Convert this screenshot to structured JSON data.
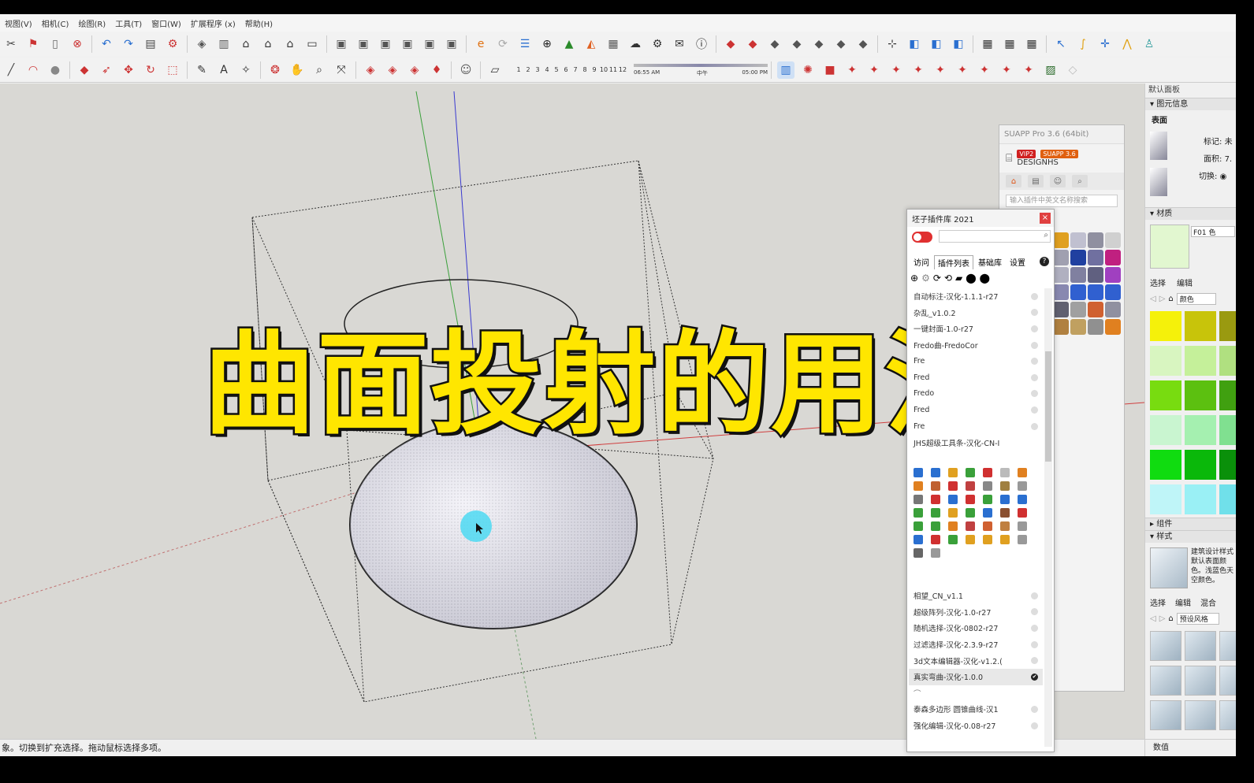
{
  "menu": {
    "items": [
      "视图(V)",
      "相机(C)",
      "绘图(R)",
      "工具(T)",
      "窗口(W)",
      "扩展程序 (x)",
      "帮助(H)"
    ]
  },
  "shadow": {
    "months": [
      "1",
      "2",
      "3",
      "4",
      "5",
      "6",
      "7",
      "8",
      "9",
      "10",
      "11",
      "12"
    ],
    "time_start": "06:55 AM",
    "time_mid": "中午",
    "time_end": "05:00 PM"
  },
  "overlay_title": "曲面投射的用法",
  "status_text": "象。切换到扩充选择。拖动鼠标选择多项。",
  "suapp": {
    "title": "SUAPP Pro 3.6 (64bit)",
    "badge_vip": "VIP2",
    "badge_ver": "SUAPP 3.6",
    "user": "DESIGNHS",
    "search_placeholder": "输入插件中英文名称搜索"
  },
  "plugin_window": {
    "title": "坯子插件库 2021",
    "close": "×",
    "tabs": [
      "访问",
      "插件列表",
      "基础库",
      "设置"
    ],
    "help": "?",
    "items_top": [
      "自动标注-汉化-1.1.1-r27",
      "杂乱_v1.0.2",
      "一键封面-1.0-r27",
      "Fredo曲-FredoCor",
      "Fre",
      "Fred",
      "Fredo",
      "Fred",
      "Fre",
      "JHS超级工具条-汉化-CN-I"
    ],
    "items_bottom": [
      "相望_CN_v1.1",
      "超级阵列-汉化-1.0-r27",
      "随机选择-汉化-0802-r27",
      "过滤选择-汉化-2.3.9-r27",
      "3d文本编辑器-汉化-v1.2.(",
      "真实弯曲-汉化-1.0.0",
      "",
      "泰森多边形 圆锥曲线-汉1",
      "强化编辑-汉化-0.08-r27"
    ],
    "selected_check": "✔"
  },
  "tray": {
    "title": "默认面板",
    "entity_info": "图元信息",
    "face_label": "表面",
    "tag_label": "标记:",
    "tag_value": "未",
    "area_label": "面积:",
    "area_value": "7.",
    "toggle_label": "切换:",
    "materials": "材质",
    "material_name": "F01 色",
    "select_tab": "选择",
    "edit_tab": "编辑",
    "color_dropdown": "颜色",
    "components": "组件",
    "styles": "样式",
    "style_desc": "建筑设计样式 默认表面颜色。浅蓝色天空颜色。",
    "style_select": "选择",
    "style_edit": "编辑",
    "style_mix": "混合",
    "style_dropdown": "预设风格",
    "value_label": "数值"
  },
  "colors": {
    "title_fill": "#ffe600",
    "title_stroke": "#111111",
    "viewport_bg": "#d9d8d4",
    "cursor_highlight": "#4dd9f2"
  }
}
